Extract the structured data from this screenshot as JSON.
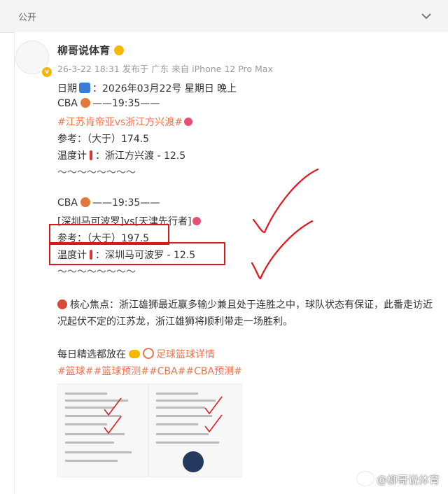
{
  "header": {
    "label": "公开"
  },
  "author": {
    "name": "柳哥说体育"
  },
  "meta": {
    "text": "26-3-22 18:31  发布于 广东  来自 iPhone 12 Pro Max"
  },
  "post": {
    "date_prefix": "日期",
    "date_text": "：2026年03月22号 星期日 晚上",
    "game1": {
      "league": "CBA",
      "time": "——19:35——",
      "topic": "#江苏肯帝亚vs浙江方兴渡#",
      "ref": "参考：（大于）174.5",
      "thermo_label": "温度计",
      "thermo_val": "：浙江方兴渡 - 12.5",
      "sep": "～～～～～～～～"
    },
    "game2": {
      "league": "CBA",
      "time": "——19:35——",
      "teams": "[深圳马可波罗]vs[天津先行者]",
      "ref": "参考：（大于）197.5",
      "thermo_label": "温度计",
      "thermo_val": "：深圳马可波罗 - 12.5",
      "sep": "～～～～～～～～"
    },
    "focus": "核心焦点：浙江雄狮最近赢多输少兼且处于连胜之中，球队状态有保证，此番走访近况起伏不定的江苏龙，浙江雄狮将顺利带走一场胜利。",
    "daily_prefix": "每日精选都放在",
    "daily_link": "足球篮球详情",
    "tags": "#篮球##篮球预测##CBA##CBA预测#"
  },
  "watermark": {
    "text": "@柳哥说体育"
  },
  "colors": {
    "accent": "#eb7350",
    "highlight_box": "#e0161b",
    "checkmark": "#e0161b",
    "verified": "#f5b800"
  },
  "icons": [
    "chevron-down-icon",
    "verified-icon",
    "calendar-icon",
    "basketball-icon",
    "thermometer-icon",
    "comet-icon",
    "fire-icon",
    "pointing-hand-icon",
    "link-icon",
    "weibo-logo-icon"
  ]
}
